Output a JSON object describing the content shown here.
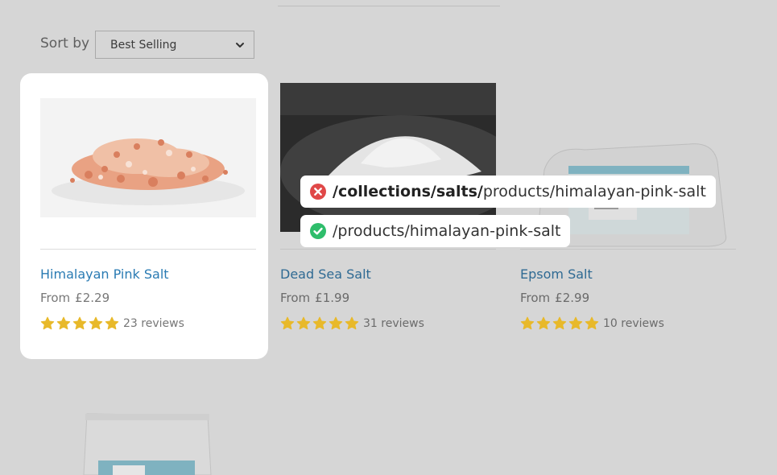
{
  "sort": {
    "label": "Sort by",
    "selected": "Best Selling"
  },
  "products": [
    {
      "title": "Himalayan Pink Salt",
      "price_prefix": "From",
      "price": "£2.29",
      "rating": 5,
      "reviews": "23 reviews"
    },
    {
      "title": "Dead Sea Salt",
      "price_prefix": "From",
      "price": "£1.99",
      "rating": 5,
      "reviews": "31 reviews"
    },
    {
      "title": "Epsom Salt",
      "price_prefix": "From",
      "price": "£2.99",
      "rating": 5,
      "reviews": "10 reviews"
    }
  ],
  "url_compare": {
    "wrong": {
      "bold": "/collections/salts/",
      "rest": "products/himalayan-pink-salt"
    },
    "right": {
      "text": "/products/himalayan-pink-salt"
    }
  },
  "colors": {
    "star": "#e8b92a",
    "link": "#2a7bb3",
    "error": "#e04848",
    "success": "#2ebd6b"
  },
  "icons": {
    "sort_chevron": "chevron-down-icon",
    "star": "star-icon",
    "wrong": "error-x-icon",
    "right": "check-circle-icon"
  }
}
